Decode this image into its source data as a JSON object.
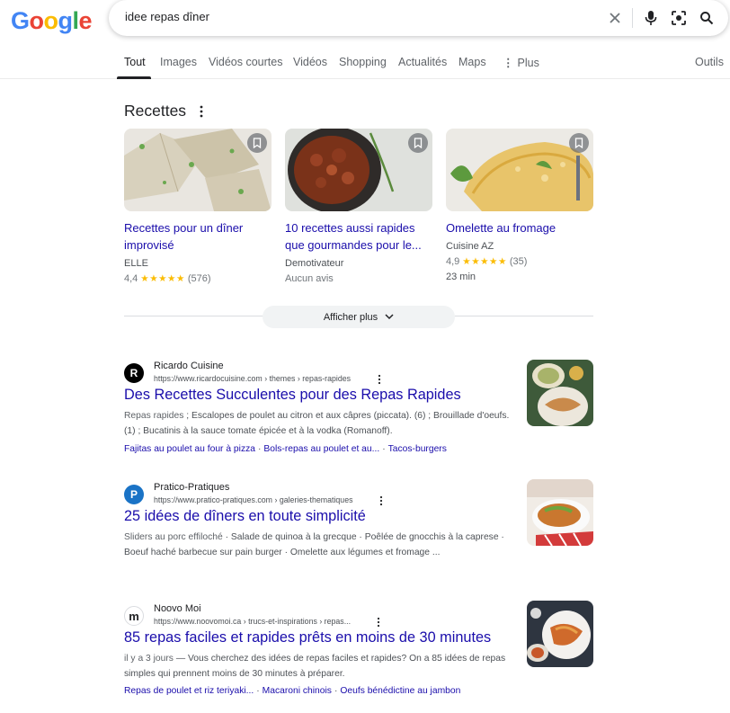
{
  "search": {
    "query": "idee repas dîner"
  },
  "tabs": [
    "Tout",
    "Images",
    "Vidéos courtes",
    "Vidéos",
    "Shopping",
    "Actualités",
    "Maps",
    "Plus",
    "Outils"
  ],
  "recipes": {
    "heading": "Recettes",
    "cards": [
      {
        "title": "Recettes pour un dîner improvisé",
        "source": "ELLE",
        "rating": "4,4",
        "stars": "★★★★★",
        "count": "(576)",
        "time": ""
      },
      {
        "title": "10 recettes aussi rapides que gourmandes pour le...",
        "source": "Demotivateur",
        "rating": "Aucun avis",
        "stars": "",
        "count": "",
        "time": ""
      },
      {
        "title": "Omelette au fromage",
        "source": "Cuisine AZ",
        "rating": "4,9",
        "stars": "★★★★★",
        "count": "(35)",
        "time": "23 min"
      }
    ],
    "more_label": "Afficher plus"
  },
  "results": [
    {
      "site": "Ricardo Cuisine",
      "url": "https://www.ricardocuisine.com › themes › repas-rapides",
      "favicon_letter": "R",
      "title": "Des Recettes Succulentes pour des Repas Rapides",
      "snippet_bold": "Repas rapides",
      "snippet_rest": " ; Escalopes de poulet au citron et aux câpres (piccata). (6) ; Brouillade d'oeufs. (1) ; Bucatinis à la sauce tomate épicée et à la vodka (Romanoff).",
      "links": [
        "Fajitas au poulet au four à pizza",
        "Bols-repas au poulet et au...",
        "Tacos-burgers"
      ]
    },
    {
      "site": "Pratico-Pratiques",
      "url": "https://www.pratico-pratiques.com › galeries-thematiques",
      "favicon_letter": "P",
      "title": "25 idées de dîners en toute simplicité",
      "snippet_bold": "Sliders au porc effiloché",
      "snippet_rest": " · Salade de quinoa à la grecque · Poêlée de gnocchis à la caprese · Boeuf haché barbecue sur pain burger · Omelette aux légumes et fromage ...",
      "links": []
    },
    {
      "site": "Noovo Moi",
      "url": "https://www.noovomoi.ca › trucs-et-inspirations › repas...",
      "favicon_letter": "m",
      "title": "85 repas faciles et rapides prêts en moins de 30 minutes",
      "snippet_bold": "il y a 3 jours",
      "snippet_rest": " — Vous cherchez des idées de repas faciles et rapides? On a 85 idées de repas simples qui prennent moins de 30 minutes à préparer.",
      "links": [
        "Repas de poulet et riz teriyaki...",
        "Macaroni chinois",
        "Oeufs bénédictine au jambon"
      ]
    }
  ],
  "colors": {
    "link": "#1a0dab",
    "star": "#fbbc04",
    "logo_blue": "#4285f4",
    "logo_red": "#ea4335",
    "logo_yellow": "#fbbc05",
    "logo_green": "#34a853"
  }
}
